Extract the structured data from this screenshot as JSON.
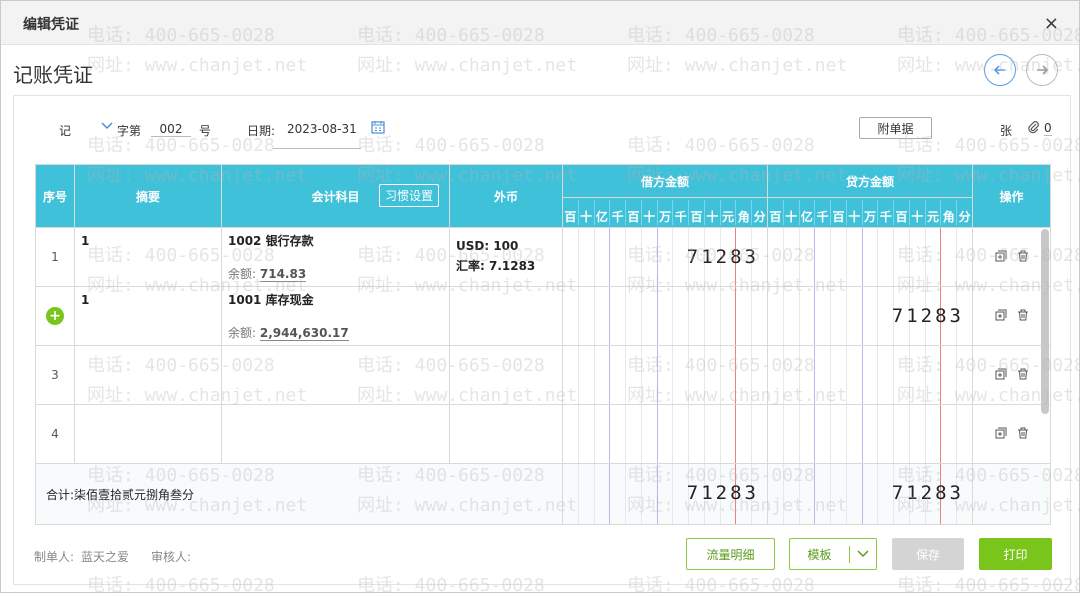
{
  "dialog": {
    "title": "编辑凭证",
    "close_glyph": "×"
  },
  "page": {
    "title": "记账凭证"
  },
  "meta": {
    "type": "记",
    "zi_label": "字第",
    "number": "002",
    "hao": "号",
    "date_label": "日期:",
    "date_value": "2023-08-31",
    "attach_button": "附单据",
    "zhang": "张",
    "attach_count": "0"
  },
  "table": {
    "headers": {
      "seq": "序号",
      "summary": "摘要",
      "account": "会计科目",
      "habit_button": "习惯设置",
      "currency": "外币",
      "debit": "借方金额",
      "credit": "贷方金额",
      "ops": "操作"
    },
    "digits": [
      "百",
      "十",
      "亿",
      "千",
      "百",
      "十",
      "万",
      "千",
      "百",
      "十",
      "元",
      "角",
      "分"
    ],
    "rows": [
      {
        "seq": "1",
        "summary": "1",
        "account": "1002 银行存款",
        "balance_label": "余额:",
        "balance": "714.83",
        "fx_line1": "USD: 100",
        "fx_line2": "汇率: 7.1283",
        "debit": "71283",
        "credit": ""
      },
      {
        "seq": "",
        "summary": "1",
        "account": "1001 库存现金",
        "balance_label": "余额:",
        "balance": "2,944,630.17",
        "fx_line1": "",
        "fx_line2": "",
        "debit": "",
        "credit": "71283"
      },
      {
        "seq": "3",
        "summary": "",
        "account": "",
        "balance_label": "",
        "balance": "",
        "fx_line1": "",
        "fx_line2": "",
        "debit": "",
        "credit": ""
      },
      {
        "seq": "4",
        "summary": "",
        "account": "",
        "balance_label": "",
        "balance": "",
        "fx_line1": "",
        "fx_line2": "",
        "debit": "",
        "credit": ""
      }
    ],
    "total": {
      "label": "合计:柒佰壹拾贰元捌角叁分",
      "debit": "71283",
      "credit": "71283"
    }
  },
  "footer": {
    "maker_label": "制单人:",
    "maker": "蓝天之爱",
    "reviewer_label": "审核人:",
    "flow_button": "流量明细",
    "template_button": "模板",
    "save_button": "保存",
    "print_button": "打印"
  },
  "watermark": {
    "phone": "电话: 400-665-0028",
    "site": "网址: www.chanjet.net"
  },
  "colors": {
    "header_bg": "#3fc1d9",
    "primary_green": "#7ac51c",
    "nav_blue": "#5b9be6"
  }
}
